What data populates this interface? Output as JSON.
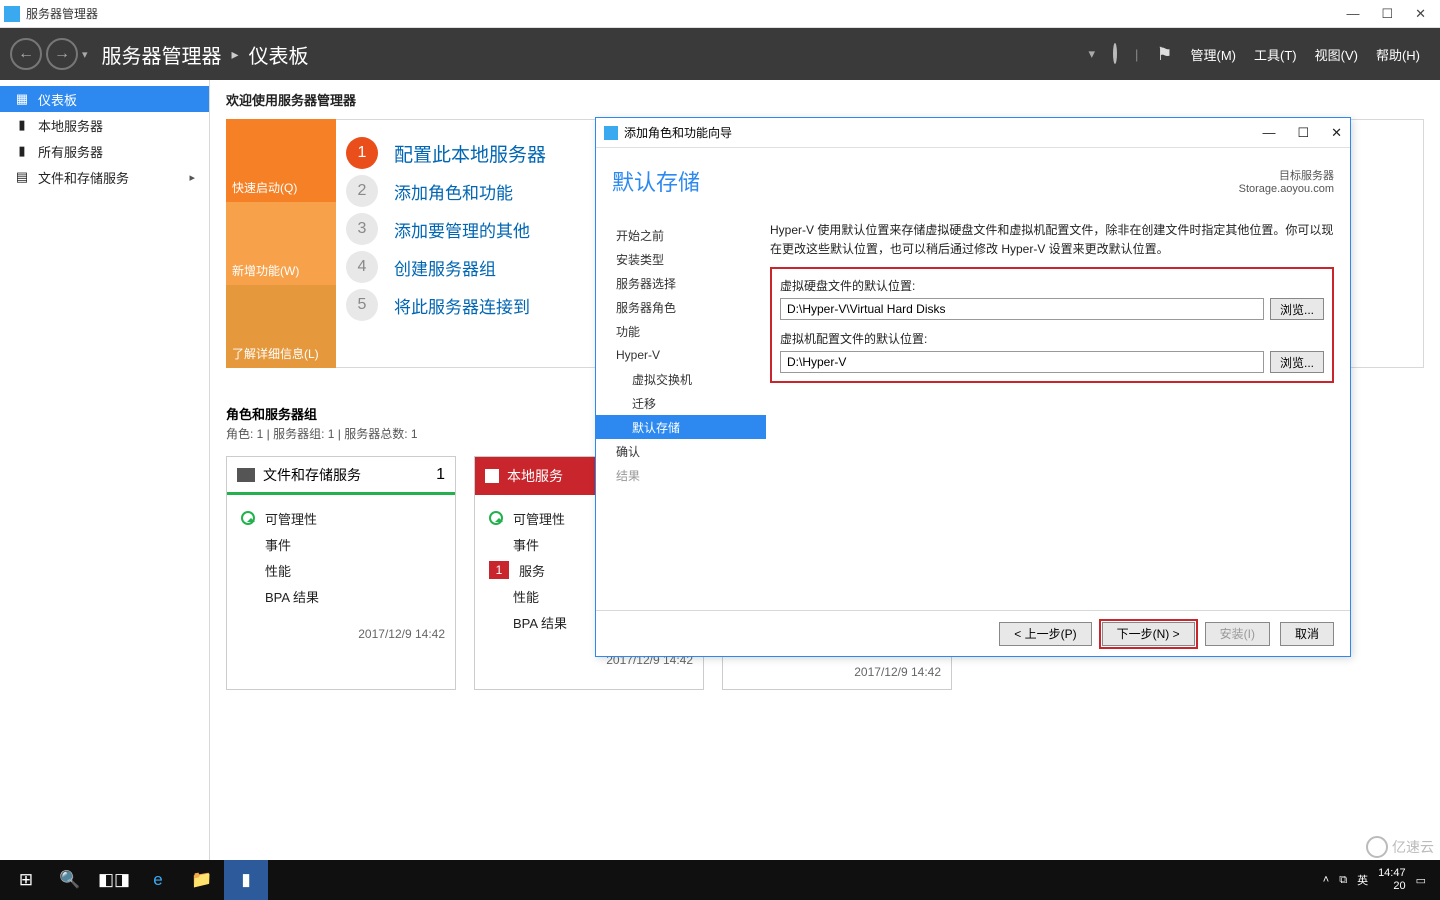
{
  "titlebar": {
    "title": "服务器管理器"
  },
  "header": {
    "crumb_root": "服务器管理器",
    "crumb_current": "仪表板",
    "menu_manage": "管理(M)",
    "menu_tools": "工具(T)",
    "menu_view": "视图(V)",
    "menu_help": "帮助(H)"
  },
  "sidebar": {
    "items": [
      {
        "label": "仪表板",
        "icon": "▦"
      },
      {
        "label": "本地服务器",
        "icon": "▮"
      },
      {
        "label": "所有服务器",
        "icon": "▮"
      },
      {
        "label": "文件和存储服务",
        "icon": "▤",
        "chevron": "▸"
      }
    ]
  },
  "main": {
    "welcome": "欢迎使用服务器管理器",
    "tiles": [
      {
        "label": "快速启动(Q)"
      },
      {
        "label": "新增功能(W)"
      },
      {
        "label": "了解详细信息(L)"
      }
    ],
    "steps": [
      {
        "num": "1",
        "label": "配置此本地服务器"
      },
      {
        "num": "2",
        "label": "添加角色和功能"
      },
      {
        "num": "3",
        "label": "添加要管理的其他"
      },
      {
        "num": "4",
        "label": "创建服务器组"
      },
      {
        "num": "5",
        "label": "将此服务器连接到"
      }
    ],
    "roles_header": "角色和服务器组",
    "roles_sub": "角色: 1 | 服务器组: 1 | 服务器总数: 1",
    "card1": {
      "title": "文件和存储服务",
      "count": "1",
      "rows": [
        {
          "label": "可管理性"
        },
        {
          "label": "事件"
        },
        {
          "label": "性能"
        },
        {
          "label": "BPA 结果"
        }
      ],
      "timestamp": "2017/12/9 14:42"
    },
    "card2": {
      "title": "本地服务",
      "rows": [
        {
          "label": "可管理性"
        },
        {
          "label": "事件"
        },
        {
          "label": "服务",
          "err": "1"
        },
        {
          "label": "性能"
        },
        {
          "label": "BPA 结果"
        }
      ],
      "timestamp": "2017/12/9 14:42"
    },
    "card3_timestamp": "2017/12/9 14:42"
  },
  "wizard": {
    "title": "添加角色和功能向导",
    "page_title": "默认存储",
    "target_label": "目标服务器",
    "target_value": "Storage.aoyou.com",
    "nav": [
      {
        "label": "开始之前"
      },
      {
        "label": "安装类型"
      },
      {
        "label": "服务器选择"
      },
      {
        "label": "服务器角色"
      },
      {
        "label": "功能"
      },
      {
        "label": "Hyper-V"
      },
      {
        "label": "虚拟交换机",
        "sub": true
      },
      {
        "label": "迁移",
        "sub": true
      },
      {
        "label": "默认存储",
        "sub": true,
        "selected": true
      },
      {
        "label": "确认"
      },
      {
        "label": "结果",
        "disabled": true
      }
    ],
    "desc": "Hyper-V 使用默认位置来存储虚拟硬盘文件和虚拟机配置文件，除非在创建文件时指定其他位置。你可以现在更改这些默认位置，也可以稍后通过修改 Hyper-V 设置来更改默认位置。",
    "label_vhd": "虚拟硬盘文件的默认位置:",
    "value_vhd": "D:\\Hyper-V\\Virtual Hard Disks",
    "label_cfg": "虚拟机配置文件的默认位置:",
    "value_cfg": "D:\\Hyper-V",
    "browse": "浏览...",
    "btn_prev": "< 上一步(P)",
    "btn_next": "下一步(N) >",
    "btn_install": "安装(I)",
    "btn_cancel": "取消"
  },
  "taskbar": {
    "clock_time": "14:47",
    "clock_date": "20",
    "ime": "英"
  },
  "watermark": "亿速云"
}
